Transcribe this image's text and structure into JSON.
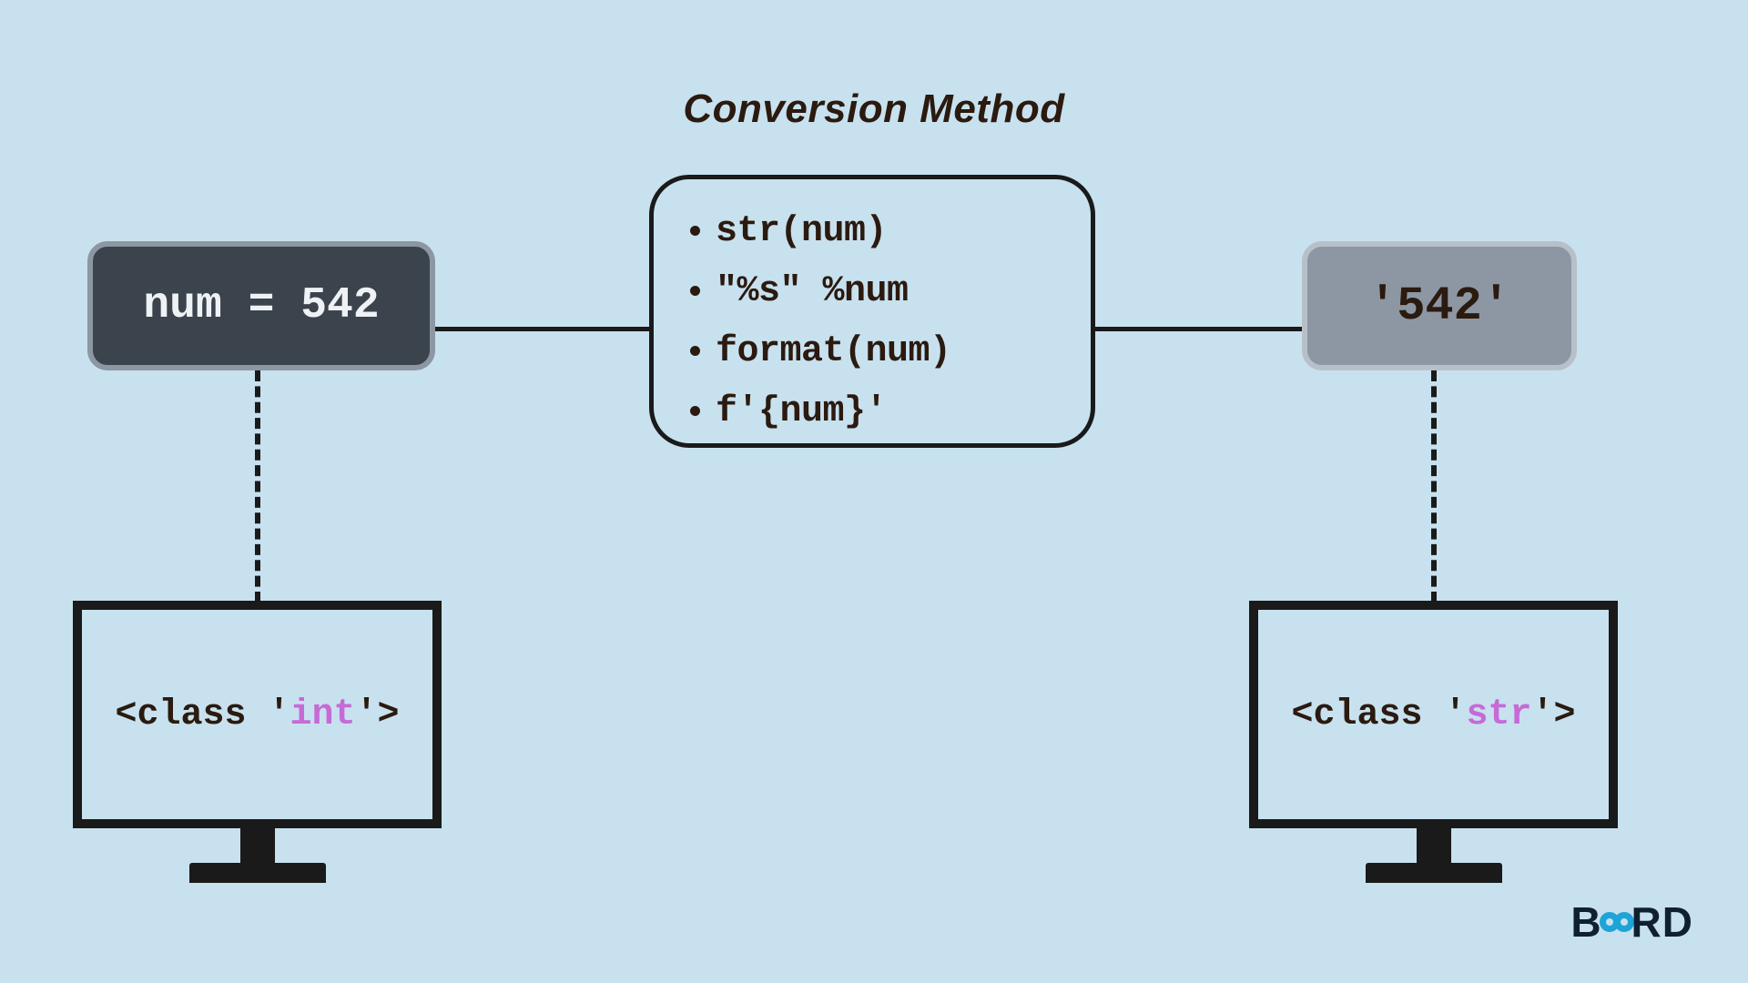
{
  "title": "Conversion Method",
  "input": {
    "code": "num = 542"
  },
  "output": {
    "code": "'542'"
  },
  "methods": [
    "str(num)",
    "\"%s\"  %num",
    "format(num)",
    "f'{num}'"
  ],
  "types": {
    "left_prefix": "<class '",
    "left_kw": "int",
    "left_suffix": "'>",
    "right_prefix": "<class '",
    "right_kw": "str",
    "right_suffix": "'>"
  },
  "logo": {
    "pre": "B",
    "post": "RD"
  }
}
